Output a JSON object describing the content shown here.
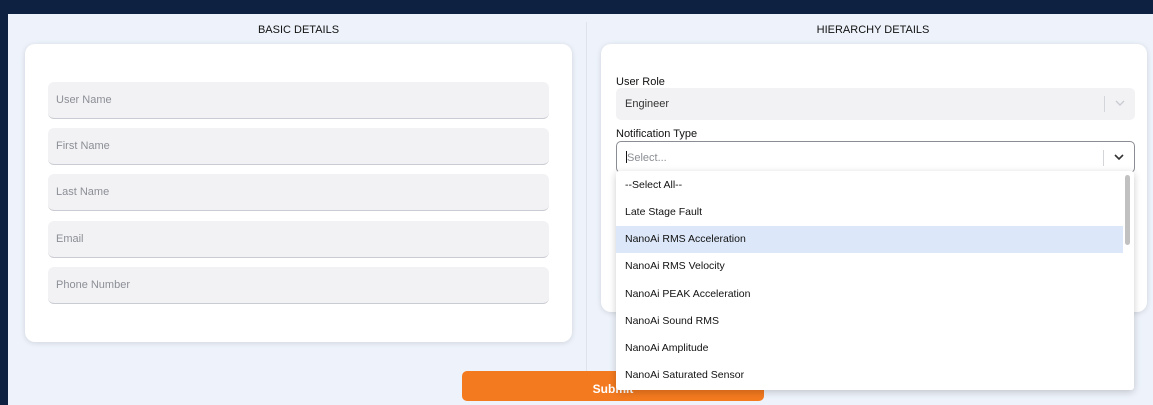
{
  "basic_details": {
    "title": "BASIC DETAILS",
    "fields": [
      {
        "placeholder": "User Name"
      },
      {
        "placeholder": "First Name"
      },
      {
        "placeholder": "Last Name"
      },
      {
        "placeholder": "Email"
      },
      {
        "placeholder": "Phone Number"
      }
    ]
  },
  "hierarchy_details": {
    "title": "HIERARCHY DETAILS",
    "user_role_label": "User Role",
    "user_role_value": "Engineer",
    "notification_label": "Notification Type",
    "notification_placeholder": "Select...",
    "options": [
      {
        "label": "--Select All--"
      },
      {
        "label": "Late Stage Fault"
      },
      {
        "label": "NanoAi RMS Acceleration",
        "highlighted": true
      },
      {
        "label": "NanoAi RMS Velocity"
      },
      {
        "label": "NanoAi PEAK Acceleration"
      },
      {
        "label": "NanoAi Sound RMS"
      },
      {
        "label": "NanoAi Amplitude"
      },
      {
        "label": "NanoAi Saturated Sensor"
      }
    ]
  },
  "submit_label": "Submit",
  "colors": {
    "outer_background": "#0f2140",
    "page_background": "#eef3fb",
    "submit": "#f47a1f",
    "highlight": "#dce8f9"
  }
}
